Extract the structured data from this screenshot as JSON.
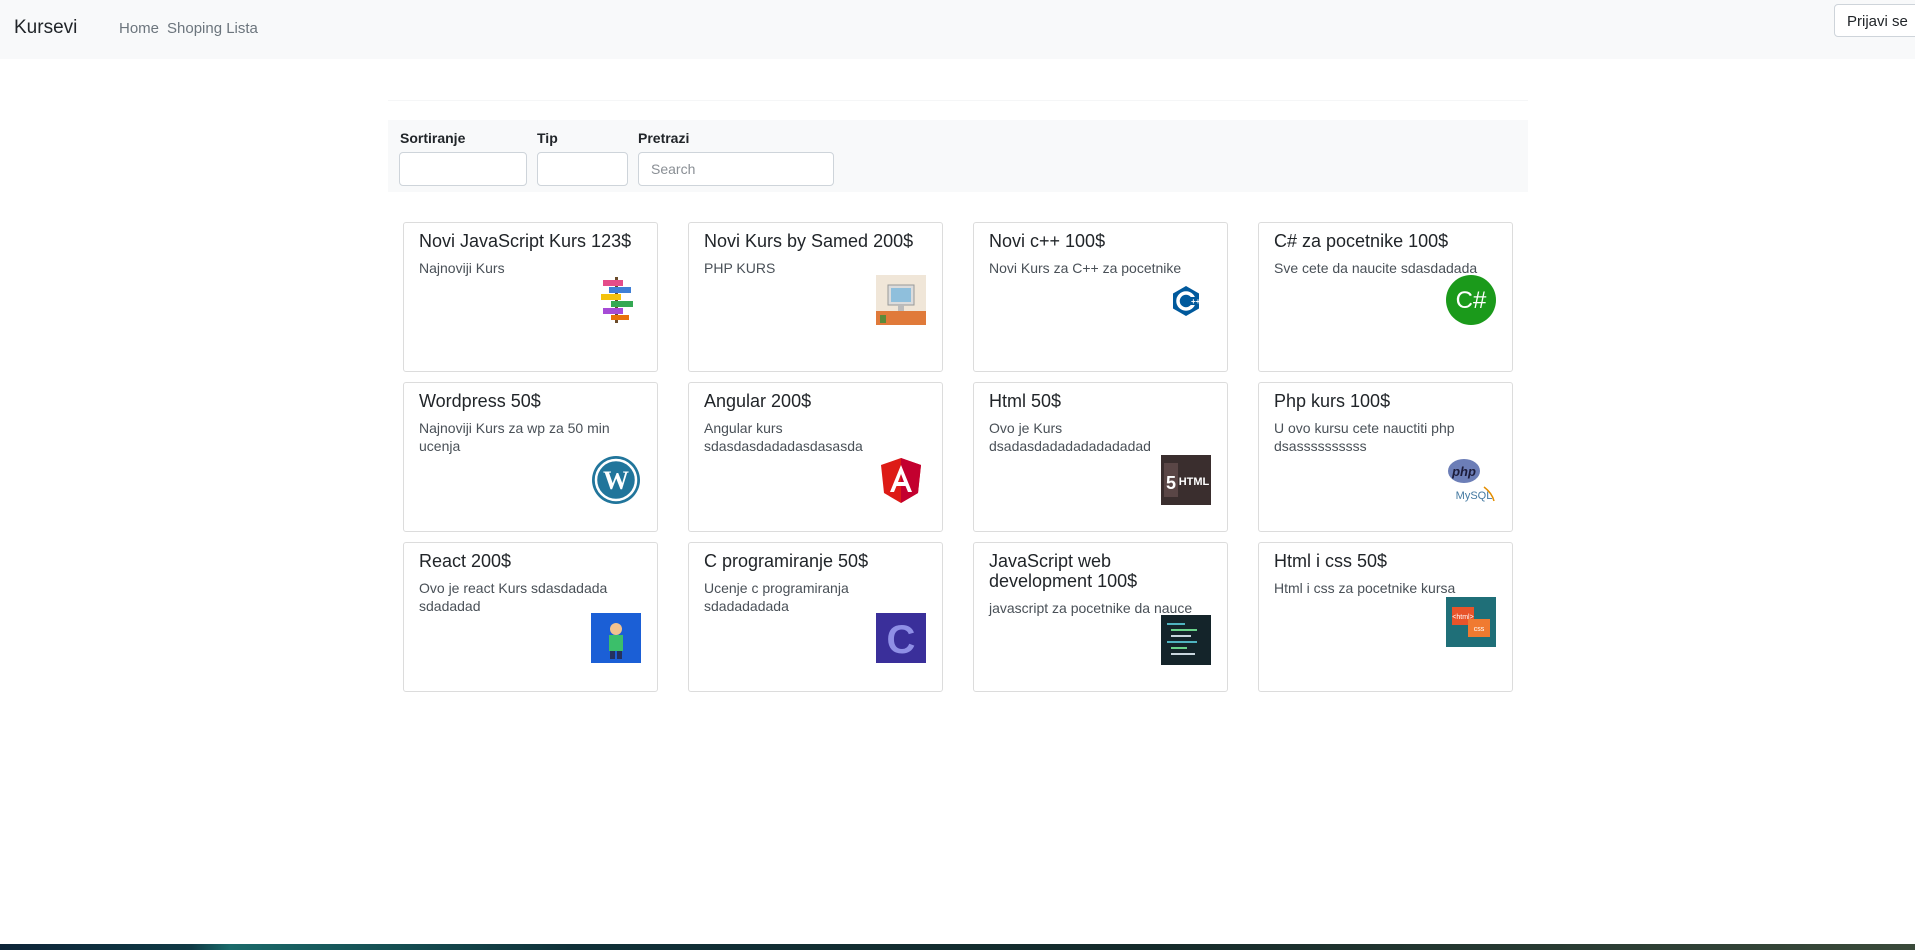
{
  "navbar": {
    "brand": "Kursevi",
    "links": [
      "Home",
      "Shoping Lista"
    ],
    "login_label": "Prijavi se"
  },
  "filters": {
    "sort_label": "Sortiranje",
    "type_label": "Tip",
    "search_label": "Pretrazi",
    "search_placeholder": "Search"
  },
  "courses": [
    {
      "title": "Novi JavaScript Kurs 123$",
      "desc": "Najnoviji Kurs",
      "icon": "js-signpost-icon"
    },
    {
      "title": "Novi Kurs by Samed 200$",
      "desc": "PHP KURS",
      "icon": "computer-desk-icon"
    },
    {
      "title": "Novi c++ 100$",
      "desc": "Novi Kurs za C++ za pocetnike",
      "icon": "cpp-logo-icon"
    },
    {
      "title": "C# za pocetnike 100$",
      "desc": "Sve cete da naucite sdasdadada",
      "icon": "csharp-logo-icon"
    },
    {
      "title": "Wordpress 50$",
      "desc": "Najnoviji Kurs za wp za 50 min ucenja",
      "icon": "wordpress-logo-icon"
    },
    {
      "title": "Angular 200$",
      "desc": "Angular kurs sdasdasdadadasdasasda",
      "icon": "angular-logo-icon"
    },
    {
      "title": "Html 50$",
      "desc": "Ovo je Kurs dsadasdadadadadadadad",
      "icon": "html5-book-icon"
    },
    {
      "title": "Php kurs 100$",
      "desc": "U ovo kursu cete nauctiti php dsassssssssss",
      "icon": "php-mysql-icon"
    },
    {
      "title": "React 200$",
      "desc": "Ovo je react Kurs sdasdadada sdadadad",
      "icon": "react-figure-icon"
    },
    {
      "title": "C programiranje 50$",
      "desc": "Ucenje c programiranja sdadadadada",
      "icon": "c-letter-icon"
    },
    {
      "title": "JavaScript web development 100$",
      "desc": "javascript za pocetnike da nauce",
      "icon": "code-screen-icon"
    },
    {
      "title": "Html i css 50$",
      "desc": "Html i css za pocetnike kursa",
      "icon": "html-css-icon"
    }
  ]
}
